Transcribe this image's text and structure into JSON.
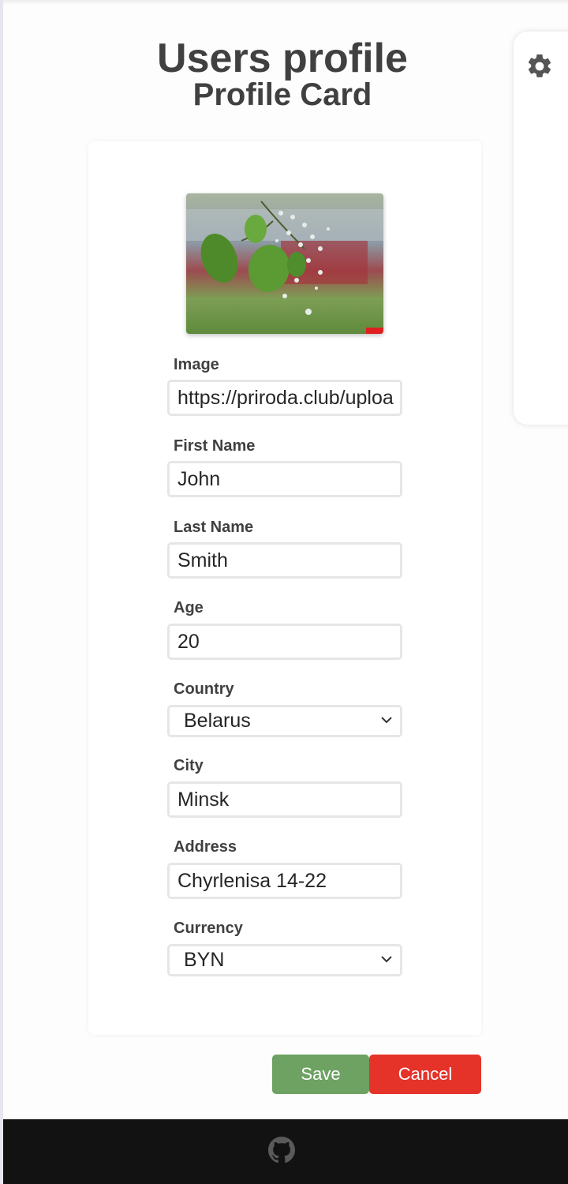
{
  "header": {
    "title": "Users profile",
    "subtitle": "Profile Card"
  },
  "settings": {
    "icon": "gear-icon"
  },
  "profile": {
    "image_alt": "profile photo of leaves and blossoms",
    "fields": {
      "image": {
        "label": "Image",
        "value": "https://priroda.club/uploa"
      },
      "first_name": {
        "label": "First Name",
        "value": "John"
      },
      "last_name": {
        "label": "Last Name",
        "value": "Smith"
      },
      "age": {
        "label": "Age",
        "value": "20"
      },
      "country": {
        "label": "Country",
        "value": "Belarus"
      },
      "city": {
        "label": "City",
        "value": "Minsk"
      },
      "address": {
        "label": "Address",
        "value": "Chyrlenisa 14-22"
      },
      "currency": {
        "label": "Currency",
        "value": "BYN"
      }
    }
  },
  "actions": {
    "save_label": "Save",
    "cancel_label": "Cancel"
  },
  "footer": {
    "icon": "github-icon"
  },
  "colors": {
    "save": "#6da262",
    "cancel": "#e6332a",
    "footer": "#121212"
  }
}
